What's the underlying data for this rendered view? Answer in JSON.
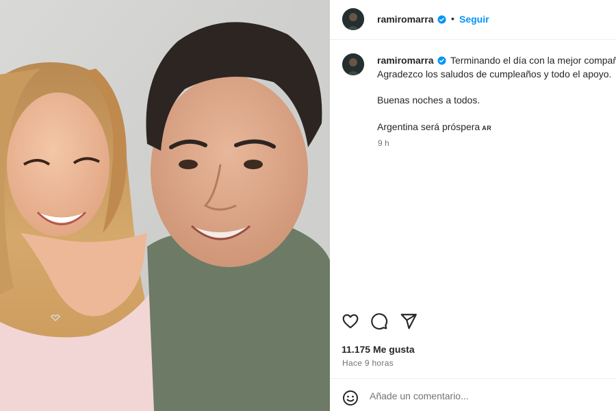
{
  "post": {
    "username": "ramiromarra",
    "verified": true,
    "follow_label": "Seguir",
    "separator": "•"
  },
  "caption": {
    "line1": "Terminando el día con la mejor compañía.",
    "line2": "Agradezco los saludos de cumpleaños y todo el apoyo.",
    "line3": "Buenas noches a todos.",
    "line4": "Argentina será próspera",
    "flag": "AR",
    "time": "9 h"
  },
  "actions": {
    "like_icon": "heart-icon",
    "comment_icon": "comment-icon",
    "share_icon": "send-icon"
  },
  "likes_text": "11.175 Me gusta",
  "time_ago": "Hace 9 horas",
  "comment": {
    "placeholder": "Añade un comentario...",
    "emoji_icon": "emoji-icon"
  },
  "colors": {
    "accent": "#0095f6",
    "verified": "#0095f6",
    "text": "#262626",
    "secondary": "#737373"
  }
}
